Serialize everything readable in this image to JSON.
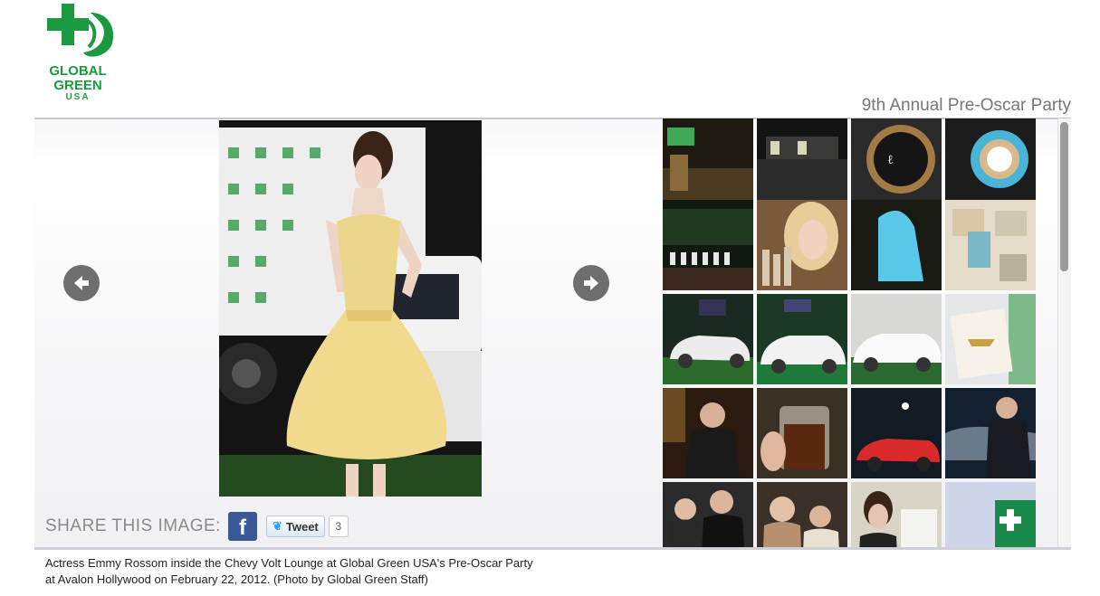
{
  "logo": {
    "line1": "GLOBAL",
    "line2": "GREEN",
    "line3": "USA",
    "color": "#1a9a3f"
  },
  "header": {
    "title": "9th Annual Pre-Oscar Party"
  },
  "main_image": {
    "subject": "woman-in-yellow-dress"
  },
  "nav": {
    "prev_icon": "arrow-left-icon",
    "next_icon": "arrow-right-icon"
  },
  "share": {
    "label": "SHARE THIS IMAGE:",
    "facebook_glyph": "f",
    "tweet_label": "Tweet",
    "tweet_count": "3"
  },
  "caption": {
    "line1": "Actress Emmy Rossom inside the Chevy Volt Lounge at Global Green USA's Pre-Oscar Party",
    "line2": "at Avalon Hollywood on February 22, 2012. (Photo by Global Green Staff)"
  },
  "thumbnails": [
    {
      "scene": "lounge-interior"
    },
    {
      "scene": "bar-counter"
    },
    {
      "scene": "plate-artwork"
    },
    {
      "scene": "tape-roll"
    },
    {
      "scene": "product-display"
    },
    {
      "scene": "cosmetics-ad"
    },
    {
      "scene": "blue-sculpture"
    },
    {
      "scene": "gift-boxes"
    },
    {
      "scene": "car-white"
    },
    {
      "scene": "car-white-2"
    },
    {
      "scene": "car-white-3"
    },
    {
      "scene": "chevrolet-cake"
    },
    {
      "scene": "guest-portrait"
    },
    {
      "scene": "cocktail-glass"
    },
    {
      "scene": "red-car"
    },
    {
      "scene": "man-in-suit"
    },
    {
      "scene": "couple"
    },
    {
      "scene": "two-women"
    },
    {
      "scene": "woman-portrait"
    },
    {
      "scene": "global-green-sign"
    }
  ]
}
